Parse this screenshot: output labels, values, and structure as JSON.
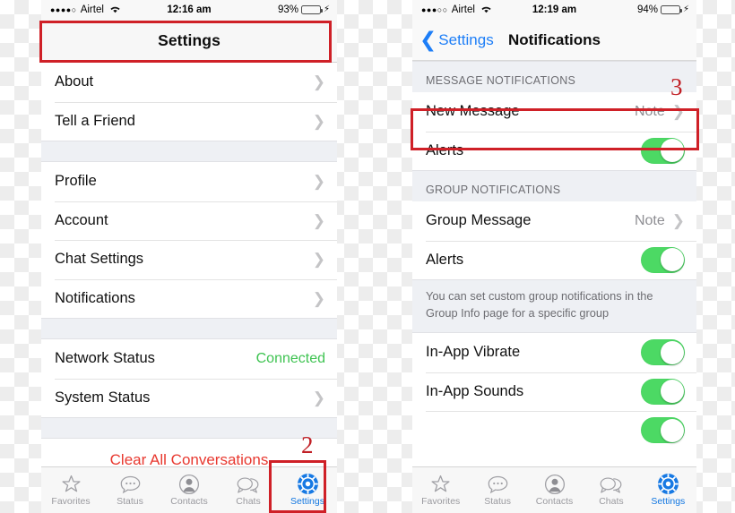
{
  "left_phone": {
    "status_bar": {
      "signal_dots": "●●●●○",
      "carrier": "Airtel",
      "wifi_icon": "wifi-icon",
      "time": "12:16 am",
      "battery_percent": "93%",
      "battery_fill": "93",
      "charging_icon": "⚡"
    },
    "navbar": {
      "title": "Settings"
    },
    "groups": [
      {
        "rows": [
          {
            "label": "About",
            "accessory": "chevron"
          },
          {
            "label": "Tell a Friend",
            "accessory": "chevron"
          }
        ]
      },
      {
        "rows": [
          {
            "label": "Profile",
            "accessory": "chevron"
          },
          {
            "label": "Account",
            "accessory": "chevron"
          },
          {
            "label": "Chat Settings",
            "accessory": "chevron"
          },
          {
            "label": "Notifications",
            "accessory": "chevron"
          }
        ]
      },
      {
        "rows": [
          {
            "label": "Network Status",
            "value": "Connected",
            "value_color": "#3ec351",
            "accessory": "none"
          },
          {
            "label": "System Status",
            "accessory": "chevron"
          }
        ]
      }
    ],
    "danger_action": {
      "label": "Clear All Conversations",
      "color": "#e8382f"
    },
    "tabbar": {
      "items": [
        {
          "label": "Favorites",
          "icon": "star-icon",
          "active": false
        },
        {
          "label": "Status",
          "icon": "status-bubble-icon",
          "active": false
        },
        {
          "label": "Contacts",
          "icon": "contact-person-icon",
          "active": false
        },
        {
          "label": "Chats",
          "icon": "chats-bubbles-icon",
          "active": false
        },
        {
          "label": "Settings",
          "icon": "gear-icon",
          "active": true
        }
      ]
    }
  },
  "right_phone": {
    "status_bar": {
      "signal_dots": "●●●○○",
      "carrier": "Airtel",
      "wifi_icon": "wifi-icon",
      "time": "12:19 am",
      "battery_percent": "94%",
      "battery_fill": "94",
      "charging_icon": "⚡"
    },
    "navbar": {
      "back_label": "Settings",
      "title": "Notifications"
    },
    "sections": [
      {
        "header": "MESSAGE NOTIFICATIONS",
        "rows": [
          {
            "label": "New Message",
            "value": "Note",
            "accessory": "chevron"
          },
          {
            "label": "Alerts",
            "accessory": "toggle",
            "toggle_on": true
          }
        ]
      },
      {
        "header": "GROUP NOTIFICATIONS",
        "rows": [
          {
            "label": "Group Message",
            "value": "Note",
            "accessory": "chevron"
          },
          {
            "label": "Alerts",
            "accessory": "toggle",
            "toggle_on": true
          }
        ],
        "footer": "You can set custom group notifications in the Group Info page for a specific group"
      },
      {
        "rows": [
          {
            "label": "In-App Vibrate",
            "accessory": "toggle",
            "toggle_on": true
          },
          {
            "label": "In-App Sounds",
            "accessory": "toggle",
            "toggle_on": true
          },
          {
            "label": "",
            "accessory": "toggle",
            "toggle_on": true,
            "clipped": true
          }
        ]
      }
    ],
    "tabbar": {
      "items": [
        {
          "label": "Favorites",
          "icon": "star-icon",
          "active": false
        },
        {
          "label": "Status",
          "icon": "status-bubble-icon",
          "active": false
        },
        {
          "label": "Contacts",
          "icon": "contact-person-icon",
          "active": false
        },
        {
          "label": "Chats",
          "icon": "chats-bubbles-icon",
          "active": false
        },
        {
          "label": "Settings",
          "icon": "gear-icon",
          "active": true
        }
      ]
    }
  },
  "annotations": {
    "highlight_color": "#cf2027",
    "step_2": "2",
    "step_3": "3"
  }
}
